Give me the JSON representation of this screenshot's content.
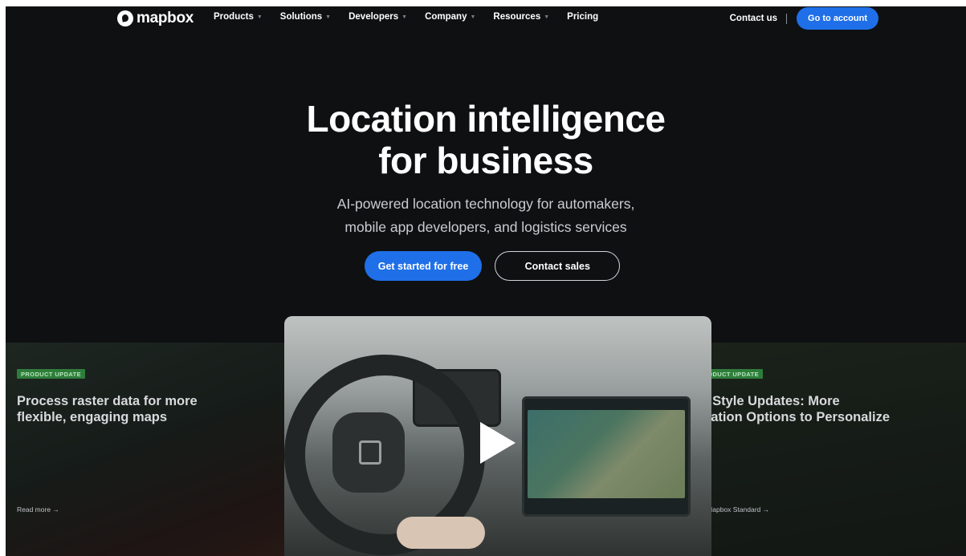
{
  "nav": {
    "logo_text": "mapbox",
    "items": [
      {
        "label": "Products"
      },
      {
        "label": "Solutions"
      },
      {
        "label": "Developers"
      },
      {
        "label": "Company"
      },
      {
        "label": "Resources"
      },
      {
        "label": "Pricing"
      }
    ],
    "contact_label": "Contact us",
    "account_label": "Go to account"
  },
  "hero": {
    "title_line1": "Location intelligence",
    "title_line2": "for business",
    "subtitle_line1": "AI-powered location technology for automakers,",
    "subtitle_line2": "mobile app developers, and logistics services",
    "cta_primary": "Get started for free",
    "cta_secondary": "Contact sales"
  },
  "cards": {
    "left": {
      "badge": "PRODUCT UPDATE",
      "title": "Process raster data for more flexible, engaging maps",
      "link": "Read more →"
    },
    "right": {
      "badge": "PRODUCT UPDATE",
      "title": "Standard Style Updates: More Customization Options to Personalize Maps",
      "link": "Explore Mapbox Standard →"
    }
  },
  "colors": {
    "background": "#0f1012",
    "accent": "#1f6fe8",
    "badge": "#2e7d3a"
  },
  "icons": {
    "logo": "mapbox-logo-icon",
    "caret": "chevron-down-icon",
    "play": "play-icon"
  }
}
